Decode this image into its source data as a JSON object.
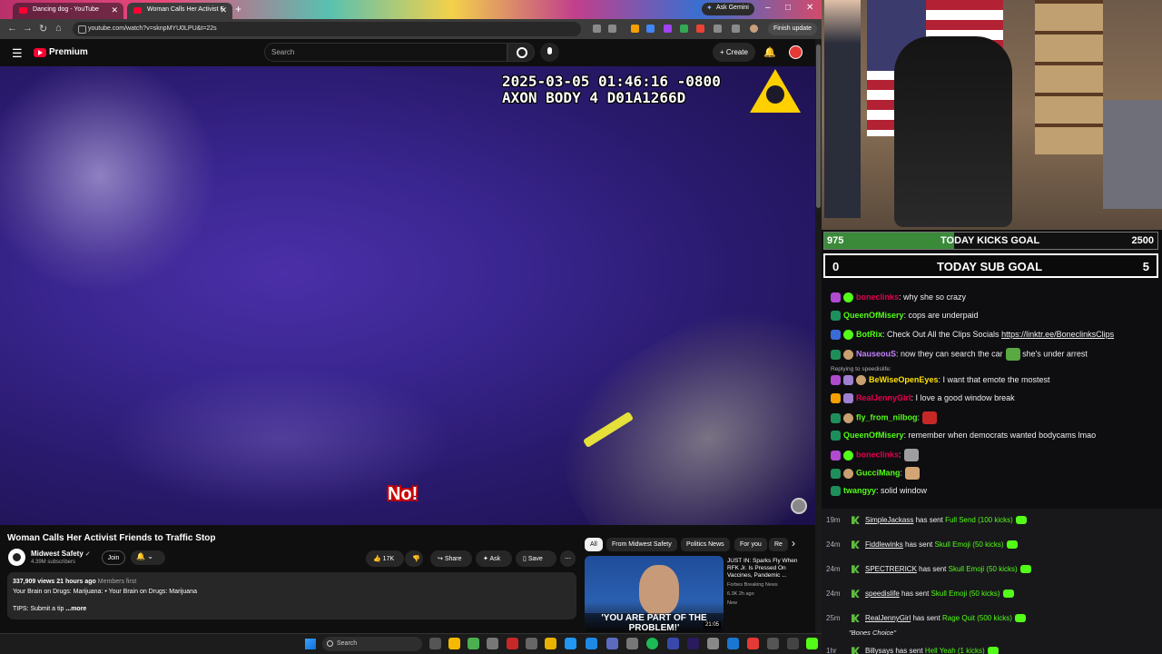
{
  "browser": {
    "tabs": [
      {
        "label": "Dancing dog - YouTube"
      },
      {
        "label": "Woman Calls Her Activist F"
      }
    ],
    "ask_gemini": "Ask Gemini",
    "url": "youtube.com/watch?v=sknpMYU0LPU&t=22s",
    "finish_update": "Finish update",
    "window_controls": {
      "minimize": "–",
      "maximize": "□",
      "close": "✕"
    }
  },
  "youtube": {
    "logo_text": "Premium",
    "search_placeholder": "Search",
    "create_label": "Create",
    "video": {
      "timestamp_line1": "2025-03-05 01:46:16 -0800",
      "timestamp_line2": "AXON BODY 4 D01A1266D",
      "caption": "No!"
    },
    "title": "Woman Calls Her Activist Friends to Traffic Stop",
    "channel": {
      "name": "Midwest Safety",
      "subscribers": "4.39M subscribers",
      "join": "Join"
    },
    "actions": {
      "likes": "17K",
      "share": "Share",
      "ask": "Ask",
      "save": "Save",
      "more": "⋯"
    },
    "description": {
      "stats": "337,909 views  21 hours ago",
      "members": "Members first",
      "line2_prefix": "Your Brain on Drugs: Marijuana:",
      "line2_link": "• Your Brain on Drugs: Marijuana",
      "line3": "TIPS: Submit a tip",
      "more": "...more"
    },
    "chips": [
      "All",
      "From Midwest Safety",
      "Politics News",
      "For you",
      "Re"
    ],
    "recommendation": {
      "title": "JUST IN: Sparks Fly When RFK Jr. Is Pressed On Vaccines, Pandemic ...",
      "channel": "Forbes Breaking News",
      "meta": "6.3K  2h ago",
      "badge": "New",
      "thumb_quote": "'YOU ARE PART OF THE PROBLEM!'",
      "duration": "21:05"
    }
  },
  "taskbar": {
    "search": "Search"
  },
  "goals": {
    "kicks": {
      "current": "975",
      "label": "TODAY KICKS GOAL",
      "target": "2500",
      "progress": 0.39
    },
    "subs": {
      "current": "0",
      "label": "TODAY SUB GOAL",
      "target": "5"
    }
  },
  "chat": [
    {
      "user": "boneclinks",
      "color": "#e4004f",
      "text": ": why she so crazy"
    },
    {
      "user": "QueenOfMisery",
      "color": "#53fc18",
      "text": ": cops are underpaid"
    },
    {
      "user": "BotRix",
      "color": "#53fc18",
      "text": ": Check Out All the Clips Socials ",
      "link": "https://linktr.ee/BoneclinksClips"
    },
    {
      "user": "NauseouS",
      "color": "#c480ff",
      "text": ": now they can search the car",
      "tail": " she's under arrest"
    },
    {
      "reply": "Replying to speedislife:"
    },
    {
      "user": "BeWiseOpenEyes",
      "color": "#ffe100",
      "text": ": I want that emote the mostest"
    },
    {
      "user": "RealJennyGirl",
      "color": "#e4004f",
      "text": ": I love a good window break"
    },
    {
      "user": "fly_from_nilbog",
      "color": "#53fc18",
      "text": ":"
    },
    {
      "user": "QueenOfMisery",
      "color": "#53fc18",
      "text": ": remember when democrats wanted bodycams lmao"
    },
    {
      "user": "boneclinks",
      "color": "#e4004f",
      "text": ":"
    },
    {
      "user": "GucciMang",
      "color": "#53fc18",
      "text": ":"
    },
    {
      "user": "twangyy",
      "color": "#53fc18",
      "text": ": solid window"
    }
  ],
  "events": [
    {
      "time": "19m",
      "user": "SimpleJackass",
      "gift": "Full Send (100 kicks)"
    },
    {
      "time": "24m",
      "user": "Fiddlewinks",
      "gift": "Skull Emoji (50 kicks)"
    },
    {
      "time": "24m",
      "user": "SPECTRERICK",
      "gift": "Skull Emoji (50 kicks)"
    },
    {
      "time": "24m",
      "user": "speedislife",
      "gift": "Skull Emoji (50 kicks)"
    },
    {
      "time": "25m",
      "user": "RealJennyGirl",
      "gift": "Rage Quit (500 kicks)"
    },
    {
      "time": "1hr",
      "user": "Billysays",
      "gift": "Hell Yeah (1 kicks)"
    }
  ],
  "event_connector": "has sent",
  "event_quote": "\"Bones Choice\""
}
